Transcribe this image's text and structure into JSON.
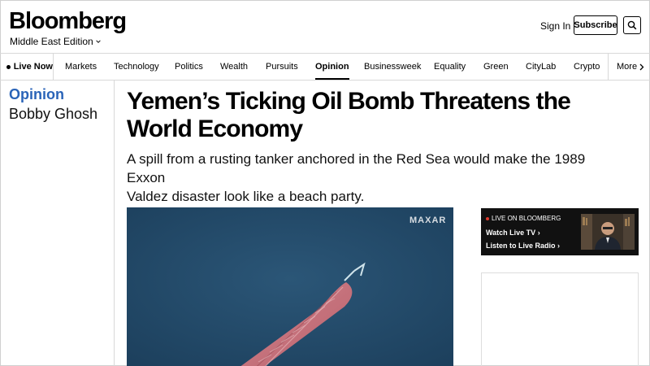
{
  "header": {
    "logo": "Bloomberg",
    "edition": "Middle East Edition",
    "sign_in": "Sign In",
    "subscribe": "Subscribe"
  },
  "nav": {
    "live": "Live Now",
    "items": [
      "Markets",
      "Technology",
      "Politics",
      "Wealth",
      "Pursuits",
      "Opinion",
      "Businessweek",
      "Equality",
      "Green",
      "CityLab",
      "Crypto"
    ],
    "active": "Opinion",
    "more": "More"
  },
  "article": {
    "section": "Opinion",
    "author": "Bobby Ghosh",
    "headline_line1": "Yemen’s Ticking Oil Bomb Threatens the",
    "headline_line2": "World Economy",
    "dek_line1": "A spill from a rusting tanker anchored in the Red Sea would make the 1989 Exxon",
    "dek_line2": "Valdez disaster look like a beach party.",
    "image_credit": "MAXAR"
  },
  "live_widget": {
    "label": "LIVE ON BLOOMBERG",
    "watch": "Watch Live TV",
    "radio": "Listen to Live Radio"
  },
  "colors": {
    "opinion_blue": "#2a64b8",
    "sea": "#234a66",
    "tanker_hull": "#c9707a",
    "live_dot": "#e03a2e"
  },
  "icons": [
    "chevron-down-icon",
    "search-icon",
    "live-dot-icon",
    "chevron-right-icon"
  ]
}
